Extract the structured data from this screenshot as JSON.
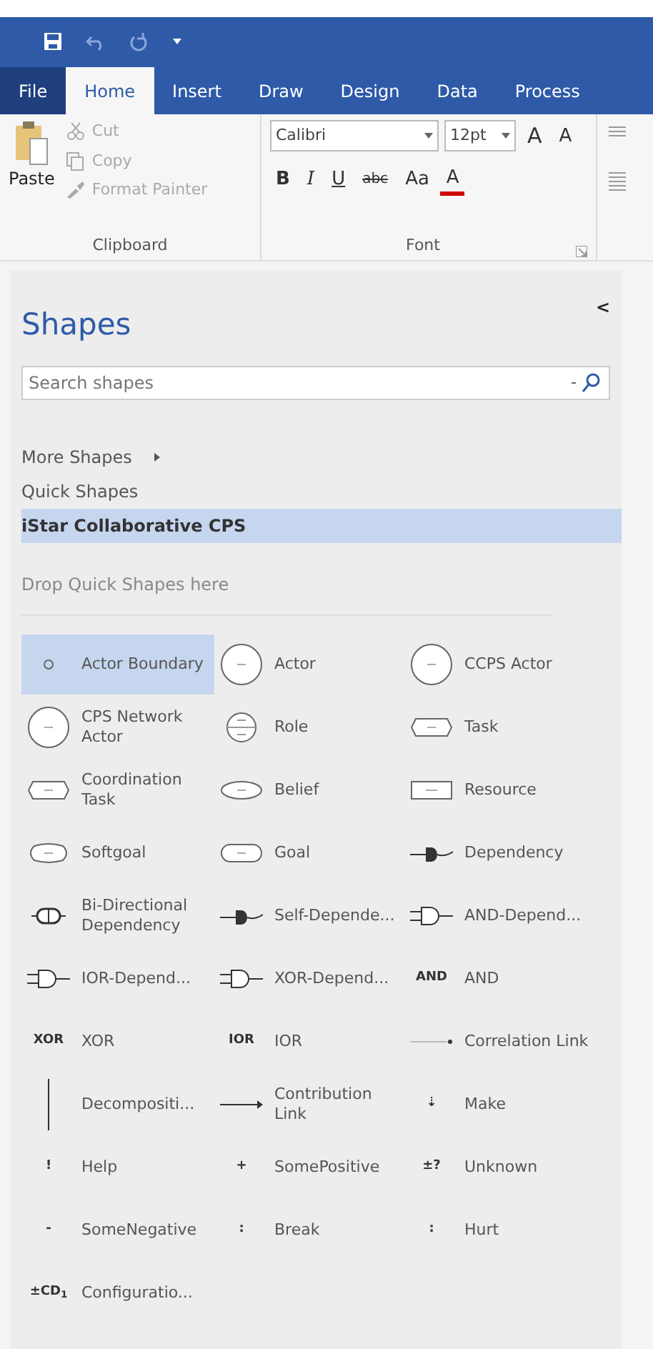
{
  "quick_access": [
    {
      "kind": "save"
    },
    {
      "kind": "undo"
    },
    {
      "kind": "redo"
    },
    {
      "kind": "customize"
    }
  ],
  "tabs": [
    {
      "label": "File",
      "kind": "file",
      "selected": false
    },
    {
      "label": "Home",
      "kind": "tab",
      "selected": true
    },
    {
      "label": "Insert",
      "kind": "tab",
      "selected": false
    },
    {
      "label": "Draw",
      "kind": "tab",
      "selected": false
    },
    {
      "label": "Design",
      "kind": "tab",
      "selected": false
    },
    {
      "label": "Data",
      "kind": "tab",
      "selected": false
    },
    {
      "label": "Process",
      "kind": "tab",
      "selected": false
    }
  ],
  "clipboard": {
    "paste": "Paste",
    "items": [
      {
        "label": "Cut",
        "disabled": true
      },
      {
        "label": "Copy",
        "disabled": true
      },
      {
        "label": "Format Painter",
        "disabled": true
      }
    ],
    "group_label": "Clipboard"
  },
  "font": {
    "family": "Calibri",
    "size": "12pt",
    "grow": "A",
    "shrink": "A",
    "bold": "B",
    "italic": "I",
    "underline": "U",
    "strike": "abc",
    "case": "Aa",
    "color_button": "A",
    "group_label": "Font"
  },
  "shapes_panel": {
    "title": "Shapes",
    "collapse": "<",
    "search_placeholder": "Search shapes",
    "nav": [
      {
        "label": "More Shapes",
        "kind": "more",
        "selected": false
      },
      {
        "label": "Quick Shapes",
        "kind": "plain",
        "selected": false
      },
      {
        "label": "iStar Collaborative CPS",
        "kind": "plain",
        "selected": true
      }
    ],
    "drop_hint": "Drop Quick Shapes here",
    "shapes": [
      {
        "label": "Actor Boundary",
        "kind": "dot",
        "selected": true
      },
      {
        "label": "Actor",
        "kind": "circle",
        "selected": false
      },
      {
        "label": "CCPS Actor",
        "kind": "circle",
        "selected": false
      },
      {
        "label": "CPS Network Actor",
        "kind": "circle",
        "selected": false
      },
      {
        "label": "Role",
        "kind": "role",
        "selected": false
      },
      {
        "label": "Task",
        "kind": "hexagon",
        "selected": false
      },
      {
        "label": "Coordination Task",
        "kind": "hexagon",
        "selected": false
      },
      {
        "label": "Belief",
        "kind": "ellipse",
        "selected": false
      },
      {
        "label": "Resource",
        "kind": "rect",
        "selected": false
      },
      {
        "label": "Softgoal",
        "kind": "softgoal",
        "selected": false
      },
      {
        "label": "Goal",
        "kind": "roundrect",
        "selected": false
      },
      {
        "label": "Dependency",
        "kind": "dependency",
        "selected": false
      },
      {
        "label": "Bi-Directional Dependency",
        "kind": "bidirectional",
        "selected": false
      },
      {
        "label": "Self-Depende...",
        "kind": "dependency",
        "selected": false
      },
      {
        "label": "AND-Depend...",
        "kind": "gate",
        "selected": false
      },
      {
        "label": "IOR-Depend...",
        "kind": "gate",
        "selected": false
      },
      {
        "label": "XOR-Depend...",
        "kind": "gate",
        "selected": false
      },
      {
        "label": "AND",
        "kind": "glyph",
        "glyph": "AND",
        "selected": false
      },
      {
        "label": "XOR",
        "kind": "glyph",
        "glyph": "XOR",
        "selected": false
      },
      {
        "label": "IOR",
        "kind": "glyph",
        "glyph": "IOR",
        "selected": false
      },
      {
        "label": "Correlation Link",
        "kind": "dotline",
        "selected": false
      },
      {
        "label": "Decompositi...",
        "kind": "vline",
        "selected": false
      },
      {
        "label": "Contribution Link",
        "kind": "arrow",
        "selected": false
      },
      {
        "label": "Make",
        "kind": "glyph",
        "glyph": "⇣",
        "selected": false
      },
      {
        "label": "Help",
        "kind": "glyph",
        "glyph": "!",
        "selected": false
      },
      {
        "label": "SomePositive",
        "kind": "glyph",
        "glyph": "+",
        "selected": false
      },
      {
        "label": "Unknown",
        "kind": "glyph",
        "glyph": "±?",
        "selected": false
      },
      {
        "label": "SomeNegative",
        "kind": "glyph",
        "glyph": "-",
        "selected": false
      },
      {
        "label": "Break",
        "kind": "glyph",
        "glyph": ":",
        "selected": false
      },
      {
        "label": "Hurt",
        "kind": "glyph",
        "glyph": ":",
        "selected": false
      },
      {
        "label": "Configuratio...",
        "kind": "glyph",
        "glyph": "±CD$_{1}$",
        "selected": false
      }
    ]
  }
}
